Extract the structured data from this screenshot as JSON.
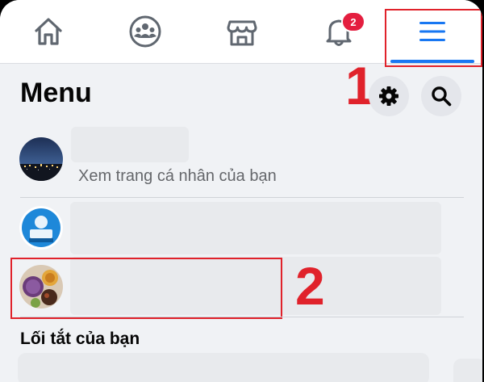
{
  "nav": {
    "tabs": [
      {
        "name": "home",
        "icon": "home-icon"
      },
      {
        "name": "groups",
        "icon": "groups-icon"
      },
      {
        "name": "marketplace",
        "icon": "marketplace-icon"
      },
      {
        "name": "notifications",
        "icon": "bell-icon",
        "badge": "2"
      },
      {
        "name": "menu",
        "icon": "hamburger-menu-icon",
        "active": true
      }
    ]
  },
  "header": {
    "title": "Menu",
    "settings_icon": "gear-icon",
    "search_icon": "search-icon"
  },
  "profile": {
    "subtitle": "Xem trang cá nhân của bạn"
  },
  "shortcuts": {
    "title": "Lối tắt của bạn"
  },
  "annotations": {
    "step1": "1",
    "step2": "2"
  },
  "colors": {
    "accent": "#1877f2",
    "badge": "#e41e3f",
    "annotation": "#e0222b",
    "background": "#f0f2f5"
  }
}
